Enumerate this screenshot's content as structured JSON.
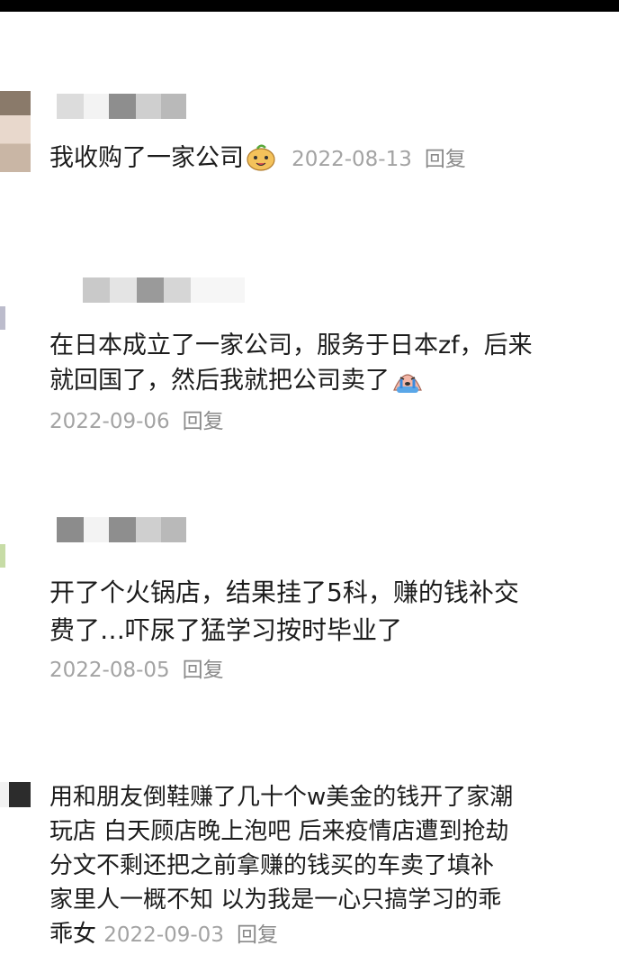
{
  "comments": [
    {
      "text": "我收购了一家公司",
      "emoji_icon": "smiling-dog-emoji",
      "date": "2022-08-13",
      "reply_label": "回复"
    },
    {
      "text": "在日本成立了一家公司，服务于日本zf，后来\n就回国了，然后我就把公司卖了",
      "emoji_icon": "crying-face-emoji",
      "date": "2022-09-06",
      "reply_label": "回复"
    },
    {
      "text": "开了个火锅店，结果挂了5科，赚的钱补交\n费了…吓尿了猛学习按时毕业了",
      "date": "2022-08-05",
      "reply_label": "回复"
    },
    {
      "text": "用和朋友倒鞋赚了几十个w美金的钱开了家潮\n玩店 白天顾店晚上泡吧 后来疫情店遭到抢劫\n分文不剩还把之前拿赚的钱买的车卖了填补\n家里人一概不知 以为我是一心只搞学习的乖\n乖女",
      "date": "2022-09-03",
      "reply_label": "回复"
    }
  ]
}
